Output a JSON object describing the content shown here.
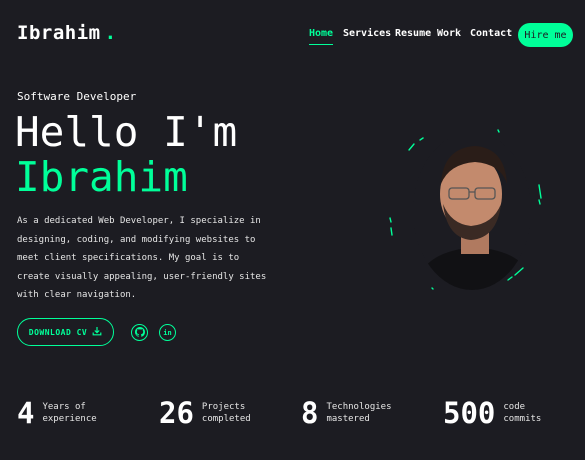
{
  "header": {
    "logo": "Ibrahim",
    "logo_dot": ".",
    "nav": [
      {
        "label": "Home",
        "active": true
      },
      {
        "label": "Services",
        "active": false
      },
      {
        "label": "Resume",
        "active": false
      },
      {
        "label": "Work",
        "active": false
      },
      {
        "label": "Contact",
        "active": false
      }
    ],
    "hire_label": "Hire me"
  },
  "hero": {
    "role": "Software Developer",
    "greeting": "Hello I'm",
    "name": "Ibrahim",
    "description": "As a dedicated Web Developer, I specialize in designing, coding, and modifying websites to meet client specifications. My goal is to create visually appealing, user-friendly sites with clear navigation.",
    "download_label": "DOWNLOAD CV",
    "download_icon": "download-icon",
    "socials": [
      {
        "icon": "github-icon"
      },
      {
        "icon": "linkedin-icon",
        "text": "in"
      }
    ]
  },
  "stats": [
    {
      "value": "4",
      "label": "Years of\nexperience"
    },
    {
      "value": "26",
      "label": "Projects\ncompleted"
    },
    {
      "value": "8",
      "label": "Technologies\nmastered"
    },
    {
      "value": "500",
      "label": "code\ncommits"
    }
  ],
  "colors": {
    "background": "#1c1c22",
    "accent": "#00ff99",
    "text": "#ffffff"
  }
}
